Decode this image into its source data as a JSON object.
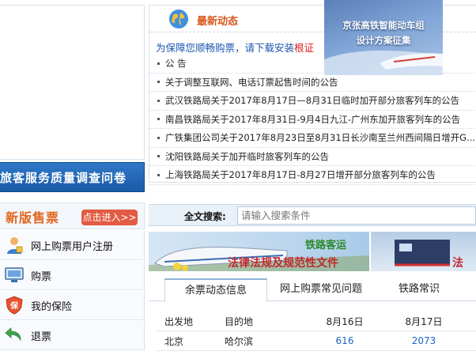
{
  "left": {
    "survey_banner": "旅客服务质量调查问卷",
    "sale": {
      "title": "新版售票",
      "enter_label": "点击进入>>"
    },
    "menu": [
      {
        "label": "网上购票用户注册",
        "icon": "user-register-icon"
      },
      {
        "label": "购票",
        "icon": "computer-ticket-icon"
      },
      {
        "label": "我的保险",
        "icon": "insurance-shield-icon"
      },
      {
        "label": "退票",
        "icon": "refund-arrow-icon"
      }
    ]
  },
  "news": {
    "title": "最新动态",
    "marquee_text": "为保障您顺畅购票，请下载安装",
    "marquee_highlight": "根证",
    "items": [
      "公 告",
      "关于调整互联网、电话订票起售时间的公告",
      "武汉铁路局关于2017年8月17日—8月31日临时加开部分旅客列车的公告",
      "南昌铁路局关于2017年8月31日-9月4日九江-广州东加开旅客列车的公告",
      "广铁集团公司关于2017年8月23日至8月31日长沙南至兰州西间隔日增开G...",
      "沈阳铁路局关于加开临时旅客列车的公告",
      "上海铁路局关于2017年8月17日-8月27日增开部分旅客列车的公告"
    ],
    "promo": {
      "line1": "京张高铁智能动车组",
      "line2": "设计方案征集"
    }
  },
  "search": {
    "label": "全文搜索:",
    "placeholder": "请输入搜索条件"
  },
  "banners": {
    "a_title": "铁路客运",
    "a_subtitle": "法律法规及规范性文件",
    "b_subtitle": "法"
  },
  "tabs": [
    {
      "label": "余票动态信息",
      "active": true
    },
    {
      "label": "网上购票常见问题",
      "active": false
    },
    {
      "label": "铁路常识",
      "active": false
    }
  ],
  "tickets": {
    "headers": [
      "出发地",
      "目的地",
      "8月16日",
      "8月17日"
    ],
    "rows": [
      {
        "from": "北京",
        "to": "哈尔滨",
        "d1": "616",
        "d2": "2073"
      }
    ]
  },
  "colors": {
    "accent_blue": "#1a66c4",
    "news_title": "#d8561c",
    "sale_title": "#e2641c",
    "enter_button": "#e25b43",
    "banner_red": "#c0282c"
  }
}
